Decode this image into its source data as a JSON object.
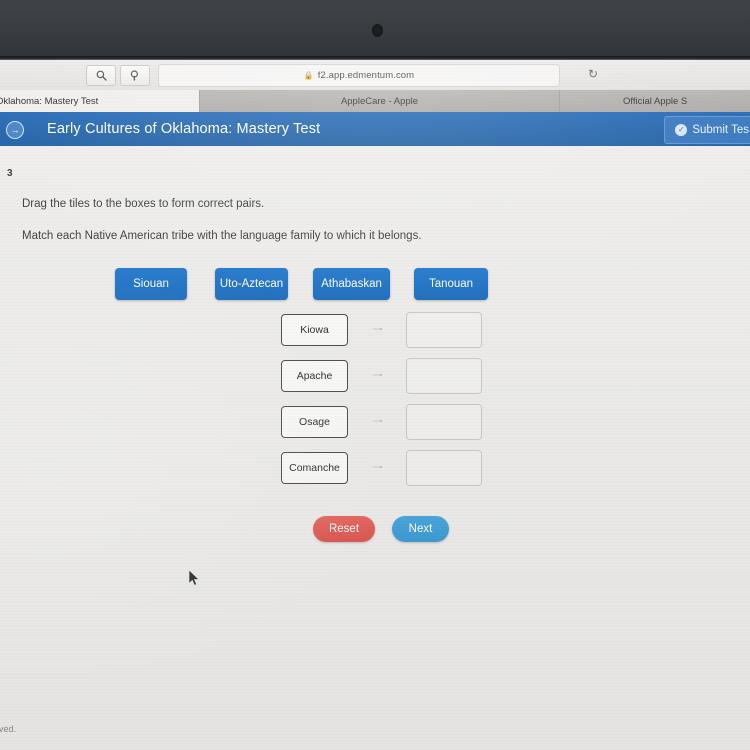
{
  "browser": {
    "url": "f2.app.edmentum.com",
    "lock_icon": "lock-icon",
    "zoom_out_icon": "magnifier-minus-icon",
    "zoom_in_icon": "magnifier-plus-icon",
    "reload_icon": "reload-icon",
    "reload_glyph": "↻",
    "tabs": [
      {
        "label": "Oklahoma: Mastery Test",
        "active": true
      },
      {
        "label": "AppleCare - Apple",
        "active": false
      },
      {
        "label": "Official Apple S",
        "active": false
      }
    ]
  },
  "appbar": {
    "back_icon": "arrow-right-circle-icon",
    "back_glyph": "→",
    "title": "Early Cultures of Oklahoma: Mastery Test",
    "submit_label": "Submit Tes",
    "submit_icon": "check-circle-icon",
    "submit_glyph": "✓",
    "background_color": "#1b63b5"
  },
  "question": {
    "number": "3",
    "instruction_1": "Drag the tiles to the boxes to form correct pairs.",
    "instruction_2": "Match each Native American tribe with the language family to which it belongs."
  },
  "tiles": [
    {
      "label": "Siouan"
    },
    {
      "label": "Uto-Aztecan"
    },
    {
      "label": "Athabaskan"
    },
    {
      "label": "Tanouan"
    }
  ],
  "tile_color": "#1a6cbe",
  "pairs": [
    {
      "source": "Kiowa",
      "target_value": ""
    },
    {
      "source": "Apache",
      "target_value": ""
    },
    {
      "source": "Osage",
      "target_value": ""
    },
    {
      "source": "Comanche",
      "target_value": ""
    }
  ],
  "buttons": {
    "reset_label": "Reset",
    "reset_color": "#de544e",
    "next_label": "Next",
    "next_color": "#3b9bd4"
  },
  "footer": {
    "text": "rved."
  }
}
